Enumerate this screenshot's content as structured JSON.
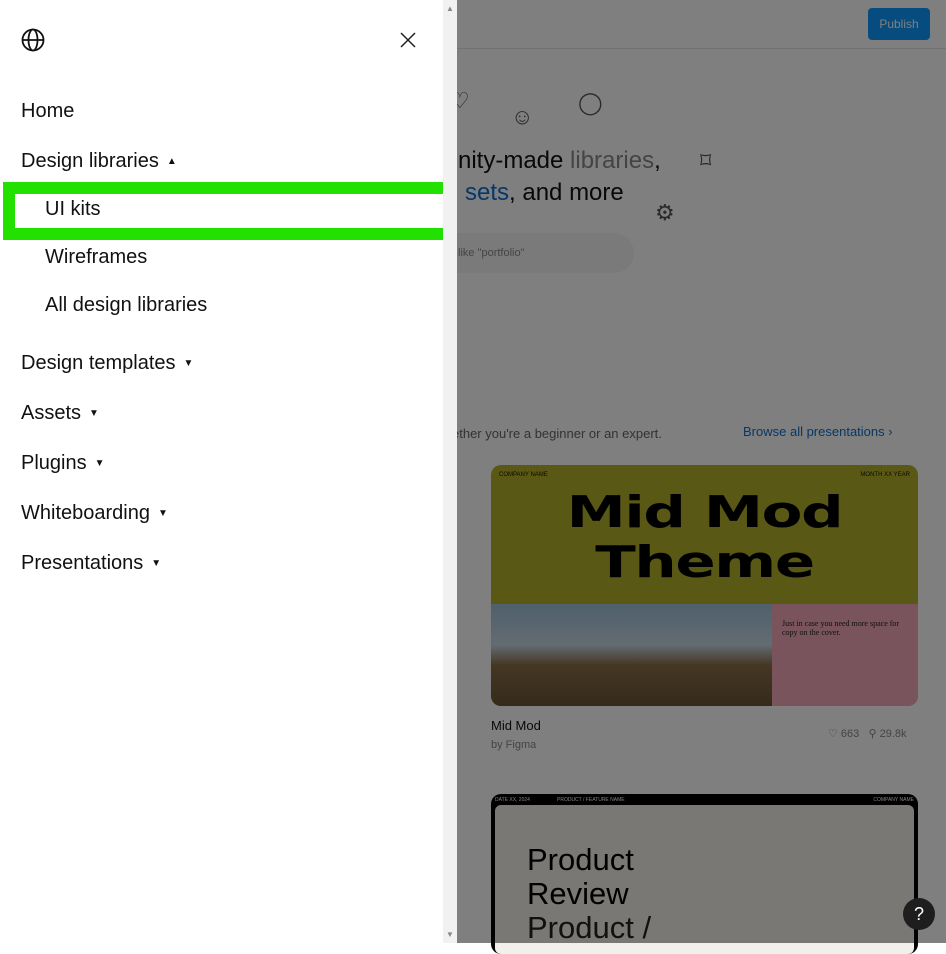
{
  "menu": {
    "globe_icon": "globe-icon",
    "close_icon": "close-icon",
    "items": [
      {
        "label": "Home"
      },
      {
        "label": "Design libraries",
        "caret": "▲"
      },
      {
        "label": "Design templates",
        "caret": "▼"
      },
      {
        "label": "Assets",
        "caret": "▼"
      },
      {
        "label": "Plugins",
        "caret": "▼"
      },
      {
        "label": "Whiteboarding",
        "caret": "▼"
      },
      {
        "label": "Presentations",
        "caret": "▼"
      }
    ],
    "sub_items": [
      {
        "label": "UI kits"
      },
      {
        "label": "Wireframes"
      },
      {
        "label": "All design libraries"
      }
    ],
    "highlight_color": "#22e000"
  },
  "page": {
    "publish_label": "Publish",
    "hero_1a": "nity-made ",
    "hero_1b": "libraries",
    "hero_1c": ",",
    "hero_2a": "sets",
    "hero_2b": ", and more",
    "search_placeholder": "like \"portfolio\"",
    "subtitle": "ether you're a beginner or an expert.",
    "browse_label": "Browse all presentations ›",
    "card1": {
      "company": "COMPANY NAME",
      "date": "MONTH XX YEAR",
      "line1": "Mid Mod",
      "line2": "Theme",
      "blurb": "Just in case you need more space for copy on the cover.",
      "title": "Mid Mod",
      "author": "by Figma",
      "likes": "♡ 663",
      "users": "29.8k"
    },
    "card2": {
      "date": "DATE XX, 2024",
      "feature": "PRODUCT / FEATURE NAME",
      "company": "COMPANY NAME",
      "line1": "Product",
      "line2": "Review",
      "line3": "Product /"
    },
    "help_label": "?"
  }
}
